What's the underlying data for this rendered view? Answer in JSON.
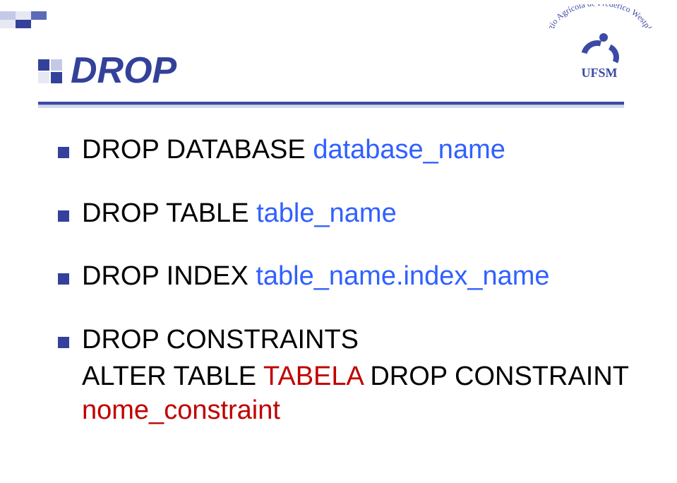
{
  "logo": {
    "arc_text_1": "Colégio Agrícola",
    "arc_text_2": "de Frederico",
    "arc_text_3": "Westphalen",
    "brand": "UFSM"
  },
  "title": "DROP",
  "items": [
    {
      "kw": "DROP DATABASE",
      "arg": "database_name"
    },
    {
      "kw": "DROP TABLE",
      "arg": "table_name"
    },
    {
      "kw": "DROP INDEX",
      "arg": "table_name.index_name"
    },
    {
      "kw": "DROP",
      "arg": "CONSTRAINTS",
      "sub_kw1": "ALTER TABLE",
      "sub_red1": "TABELA",
      "sub_kw2": "DROP CONSTRAINT",
      "sub_red2": "nome_constraint"
    }
  ]
}
